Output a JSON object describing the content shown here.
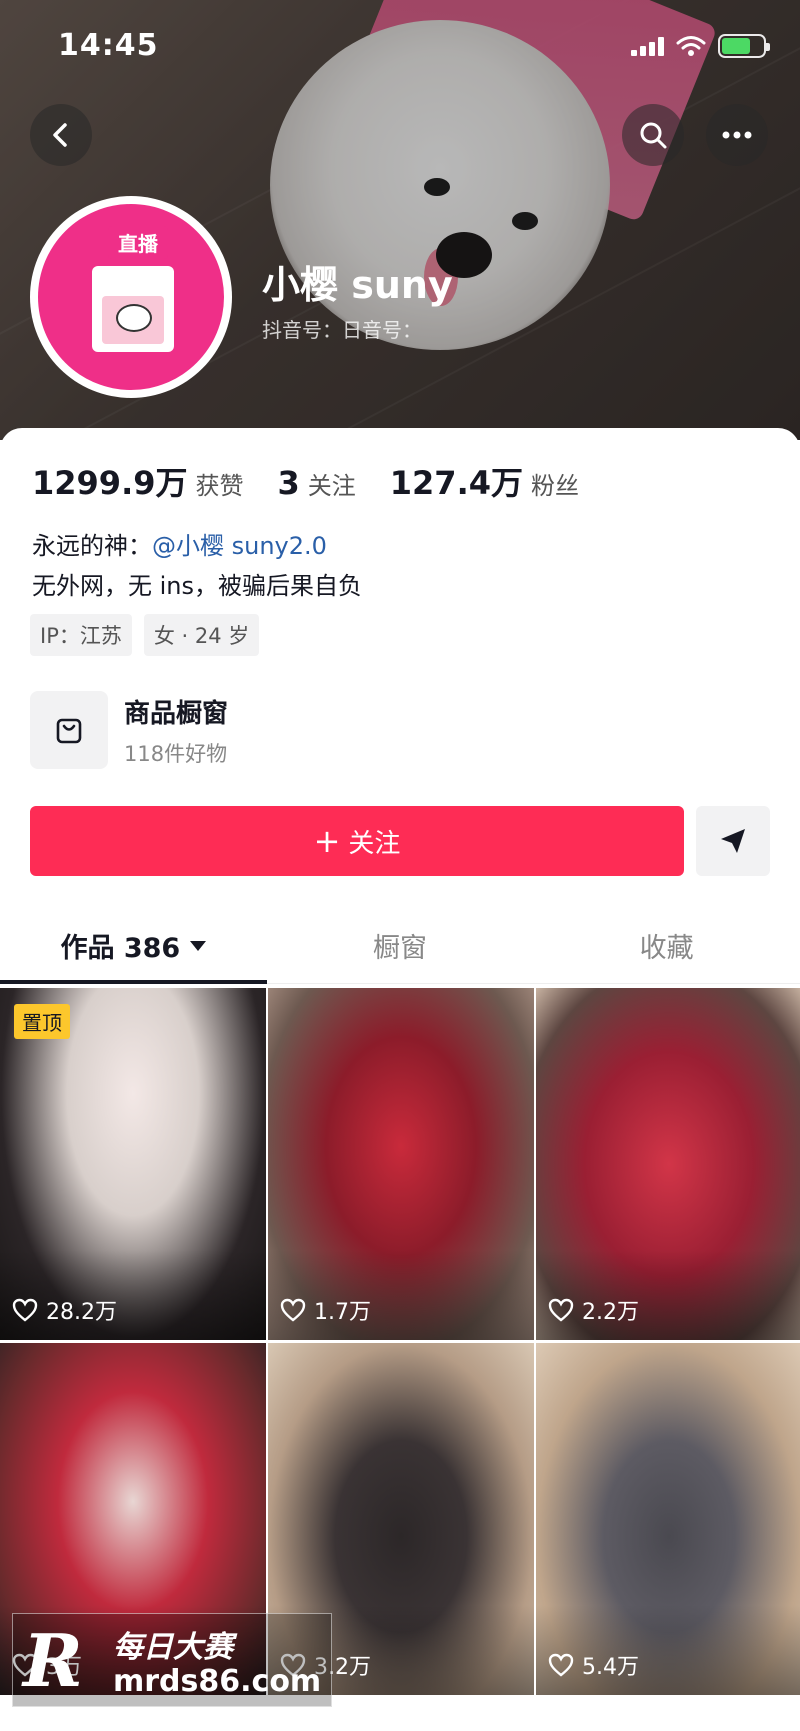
{
  "status": {
    "time": "14:45"
  },
  "profile": {
    "live_badge": "直播",
    "name": "小樱 suny",
    "douyin_id": "抖音号：日音号："
  },
  "stats": [
    {
      "value": "1299.9万",
      "label": "获赞"
    },
    {
      "value": "3",
      "label": "关注"
    },
    {
      "value": "127.4万",
      "label": "粉丝"
    }
  ],
  "bio": {
    "line1_prefix": "永远的神：",
    "line1_mention": "@小樱 suny2.0",
    "line2": "无外网，无 ins，被骗后果自负"
  },
  "tags": [
    "IP：江苏",
    "女 · 24 岁"
  ],
  "shop": {
    "title": "商品橱窗",
    "subtitle": "118件好物"
  },
  "actions": {
    "follow_label": "关注",
    "follow_plus": "+"
  },
  "tabs": [
    {
      "label": "作品 386"
    },
    {
      "label": "橱窗"
    },
    {
      "label": "收藏"
    }
  ],
  "videos": [
    {
      "likes": "28.2万",
      "pinned_label": "置顶"
    },
    {
      "likes": "1.7万"
    },
    {
      "likes": "2.2万"
    },
    {
      "likes": "3万"
    },
    {
      "likes": "3.2万"
    },
    {
      "likes": "5.4万"
    }
  ],
  "watermark": {
    "logo": "R",
    "title": "每日大赛",
    "url": "mrds86.com"
  },
  "colors": {
    "follow": "#fe2c55",
    "mention": "#2a5fa8",
    "pin": "#fcc72c",
    "avatar": "#ef2f88"
  }
}
